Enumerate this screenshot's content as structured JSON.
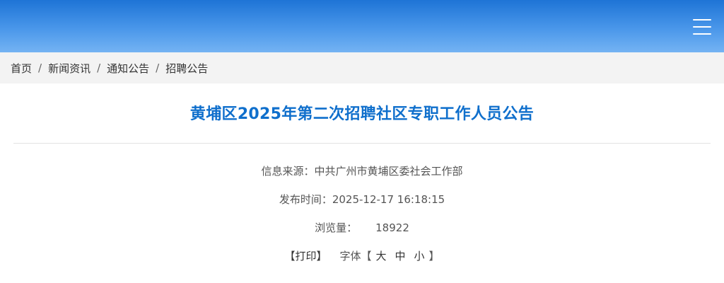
{
  "header": {
    "menu_icon": "hamburger-menu-icon",
    "gradient_top": "#1e74d6",
    "gradient_bottom": "#74b3f3"
  },
  "breadcrumb": {
    "items": [
      "首页",
      "新闻资讯",
      "通知公告",
      "招聘公告"
    ],
    "separator": "/"
  },
  "article": {
    "title": "黄埔区2025年第二次招聘社区专职工作人员公告",
    "title_color": "#0f6fcc",
    "source_label": "信息来源：",
    "source_value": "中共广州市黄埔区委社会工作部",
    "time_label": "发布时间：",
    "time_value": "2025-12-17 16:18:15",
    "views_label": "浏览量：",
    "views_value": "18922",
    "print_label": "【打印】",
    "font_label": "字体【",
    "font_large": "大",
    "font_medium": "中",
    "font_small": "小",
    "font_close": "】"
  }
}
